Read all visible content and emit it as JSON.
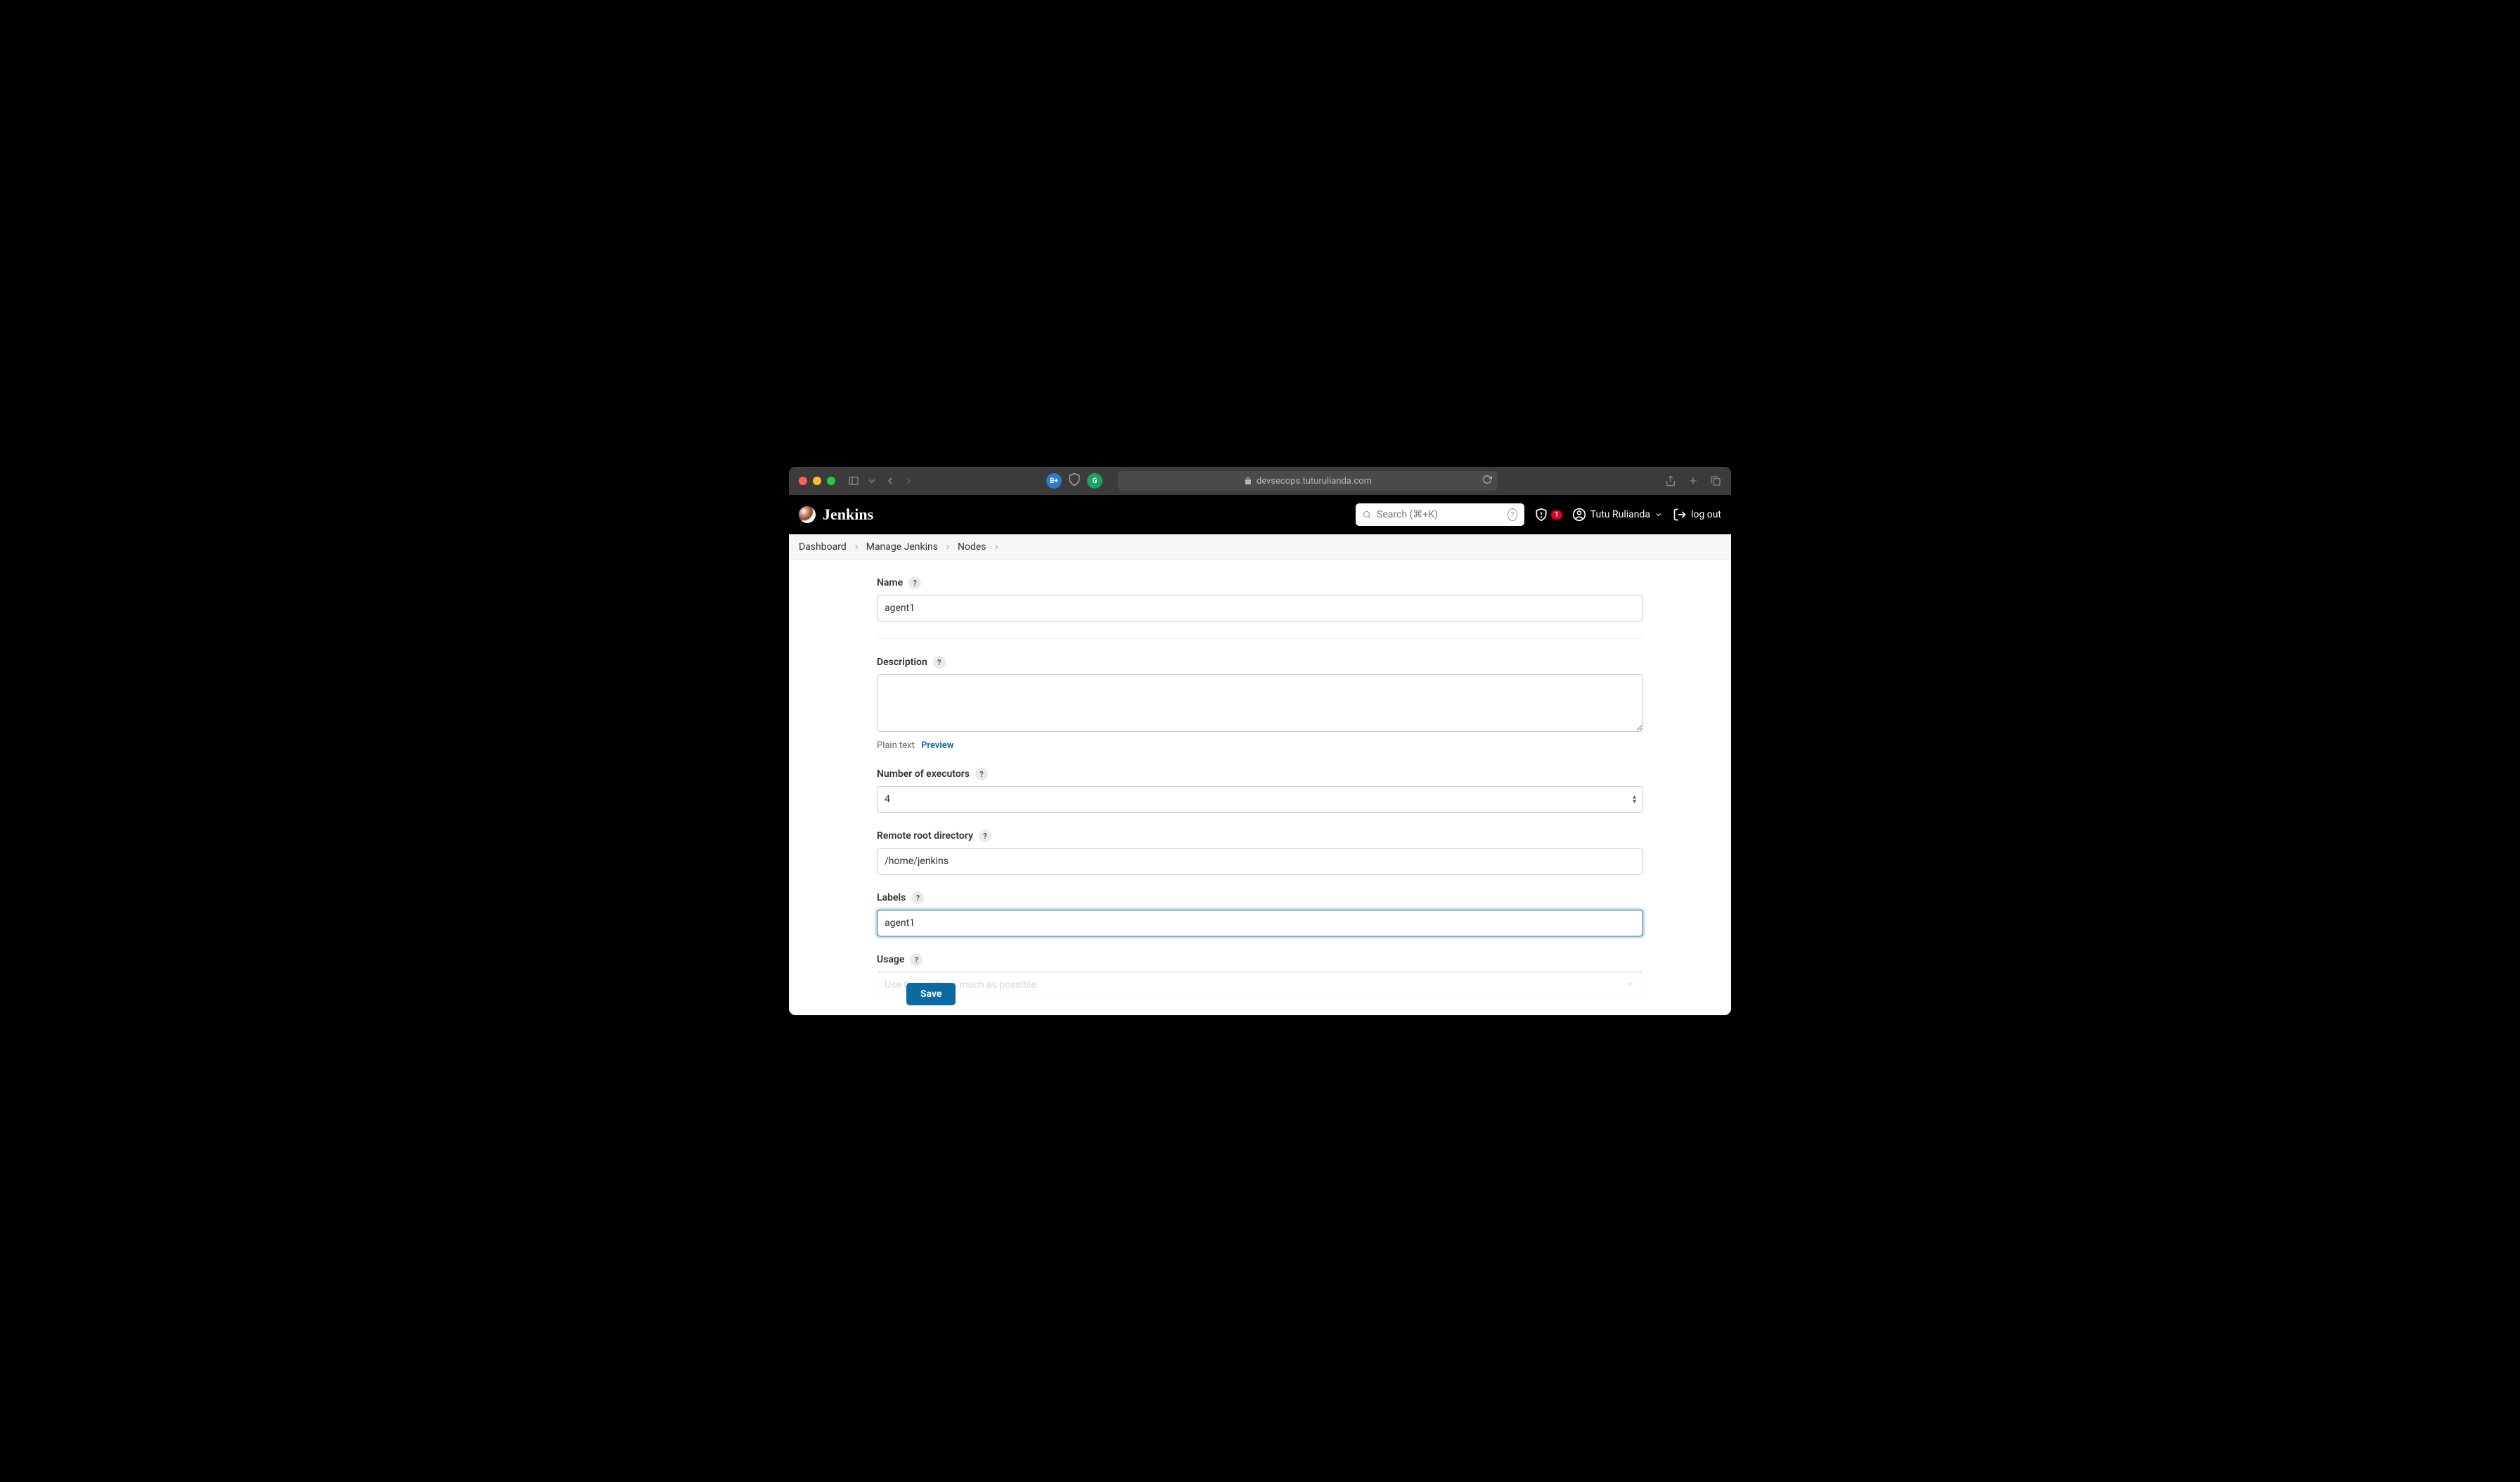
{
  "browser": {
    "url": "devsecops.tuturulianda.com"
  },
  "header": {
    "app_name": "Jenkins",
    "search_placeholder": "Search (⌘+K)",
    "alert_count": "1",
    "username": "Tutu Rulianda",
    "logout": "log out"
  },
  "breadcrumbs": {
    "items": [
      "Dashboard",
      "Manage Jenkins",
      "Nodes"
    ]
  },
  "form": {
    "name": {
      "label": "Name",
      "value": "agent1"
    },
    "description": {
      "label": "Description",
      "value": "",
      "plain_text": "Plain text",
      "preview": "Preview"
    },
    "executors": {
      "label": "Number of executors",
      "value": "4"
    },
    "remote_root": {
      "label": "Remote root directory",
      "value": "/home/jenkins"
    },
    "labels": {
      "label": "Labels",
      "value": "agent1"
    },
    "usage": {
      "label": "Usage",
      "selected": "Use this node as much as possible"
    },
    "save_button": "Save"
  }
}
